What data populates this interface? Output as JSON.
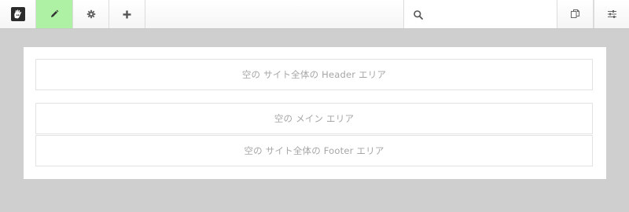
{
  "toolbar": {
    "logo_icon": "concrete5-logo-icon",
    "edit_icon": "pencil-icon",
    "settings_icon": "gear-icon",
    "add_icon": "plus-icon",
    "search": {
      "icon": "search-icon",
      "value": "",
      "placeholder": ""
    },
    "pages_icon": "copy-pages-icon",
    "options_icon": "sliders-icon",
    "active_color": "#aef0a4"
  },
  "page": {
    "areas": [
      {
        "label": "空の サイト全体の Header エリア"
      },
      {
        "label": "空の メイン エリア"
      },
      {
        "label": "空の サイト全体の Footer エリア"
      }
    ]
  }
}
